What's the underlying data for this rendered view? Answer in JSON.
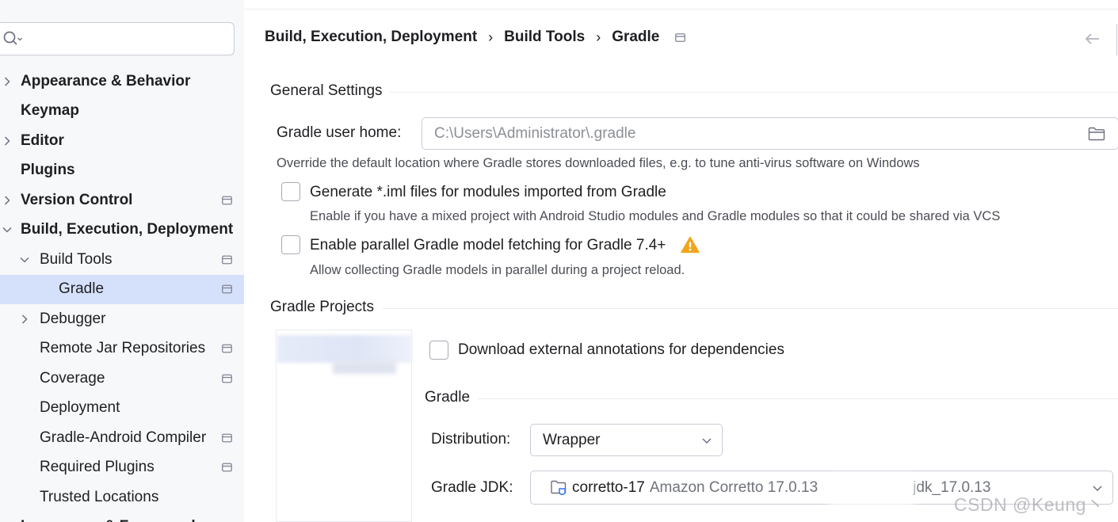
{
  "search": {
    "placeholder": ""
  },
  "sidebar": {
    "items": [
      {
        "label": "Appearance & Behavior",
        "bold": true,
        "chevron": "right",
        "indent": 0,
        "pin": false
      },
      {
        "label": "Keymap",
        "bold": true,
        "chevron": "none",
        "indent": 0,
        "pin": false
      },
      {
        "label": "Editor",
        "bold": true,
        "chevron": "right",
        "indent": 0,
        "pin": false
      },
      {
        "label": "Plugins",
        "bold": true,
        "chevron": "none",
        "indent": 0,
        "pin": false
      },
      {
        "label": "Version Control",
        "bold": true,
        "chevron": "right",
        "indent": 0,
        "pin": true
      },
      {
        "label": "Build, Execution, Deployment",
        "bold": true,
        "chevron": "down",
        "indent": 0,
        "pin": false
      },
      {
        "label": "Build Tools",
        "bold": false,
        "chevron": "down",
        "indent": 1,
        "pin": true
      },
      {
        "label": "Gradle",
        "bold": false,
        "chevron": "none",
        "indent": 2,
        "pin": true,
        "selected": true
      },
      {
        "label": "Debugger",
        "bold": false,
        "chevron": "right",
        "indent": 1,
        "pin": false
      },
      {
        "label": "Remote Jar Repositories",
        "bold": false,
        "chevron": "none",
        "indent": 1,
        "pin": true
      },
      {
        "label": "Coverage",
        "bold": false,
        "chevron": "none",
        "indent": 1,
        "pin": true
      },
      {
        "label": "Deployment",
        "bold": false,
        "chevron": "none",
        "indent": 1,
        "pin": false
      },
      {
        "label": "Gradle-Android Compiler",
        "bold": false,
        "chevron": "none",
        "indent": 1,
        "pin": true
      },
      {
        "label": "Required Plugins",
        "bold": false,
        "chevron": "none",
        "indent": 1,
        "pin": true
      },
      {
        "label": "Trusted Locations",
        "bold": false,
        "chevron": "none",
        "indent": 1,
        "pin": false
      },
      {
        "label": "Languages & Frameworks",
        "bold": true,
        "chevron": "right",
        "indent": 0,
        "pin": false
      }
    ]
  },
  "breadcrumb": {
    "items": [
      "Build, Execution, Deployment",
      "Build Tools",
      "Gradle"
    ],
    "separator": "›"
  },
  "general": {
    "title": "General Settings",
    "gradle_home_label": "Gradle user home:",
    "gradle_home_value": "C:\\Users\\Administrator\\.gradle",
    "gradle_home_hint": "Override the default location where Gradle stores downloaded files, e.g. to tune anti-virus software on Windows",
    "iml_label": "Generate *.iml files for modules imported from Gradle",
    "iml_checked": false,
    "iml_hint": "Enable if you have a mixed project with Android Studio modules and Gradle modules so that it could be shared via VCS",
    "parallel_label": "Enable parallel Gradle model fetching for Gradle 7.4+",
    "parallel_checked": false,
    "parallel_hint": "Allow collecting Gradle models in parallel during a project reload."
  },
  "projects": {
    "title": "Gradle Projects",
    "annotations_label": "Download external annotations for dependencies",
    "annotations_checked": false,
    "gradle_section": "Gradle",
    "distribution_label": "Distribution:",
    "distribution_value": "Wrapper",
    "jdk_label": "Gradle JDK:",
    "jdk_name": "corretto-17",
    "jdk_desc": "Amazon Corretto 17.0.13",
    "jdk_path_tail": "jdk_17.0.13"
  },
  "watermark": "CSDN @Keung丶",
  "colors": {
    "selection": "#d5e1fb",
    "warning": "#f2a51a",
    "jdk_icon": "#3574f0"
  }
}
